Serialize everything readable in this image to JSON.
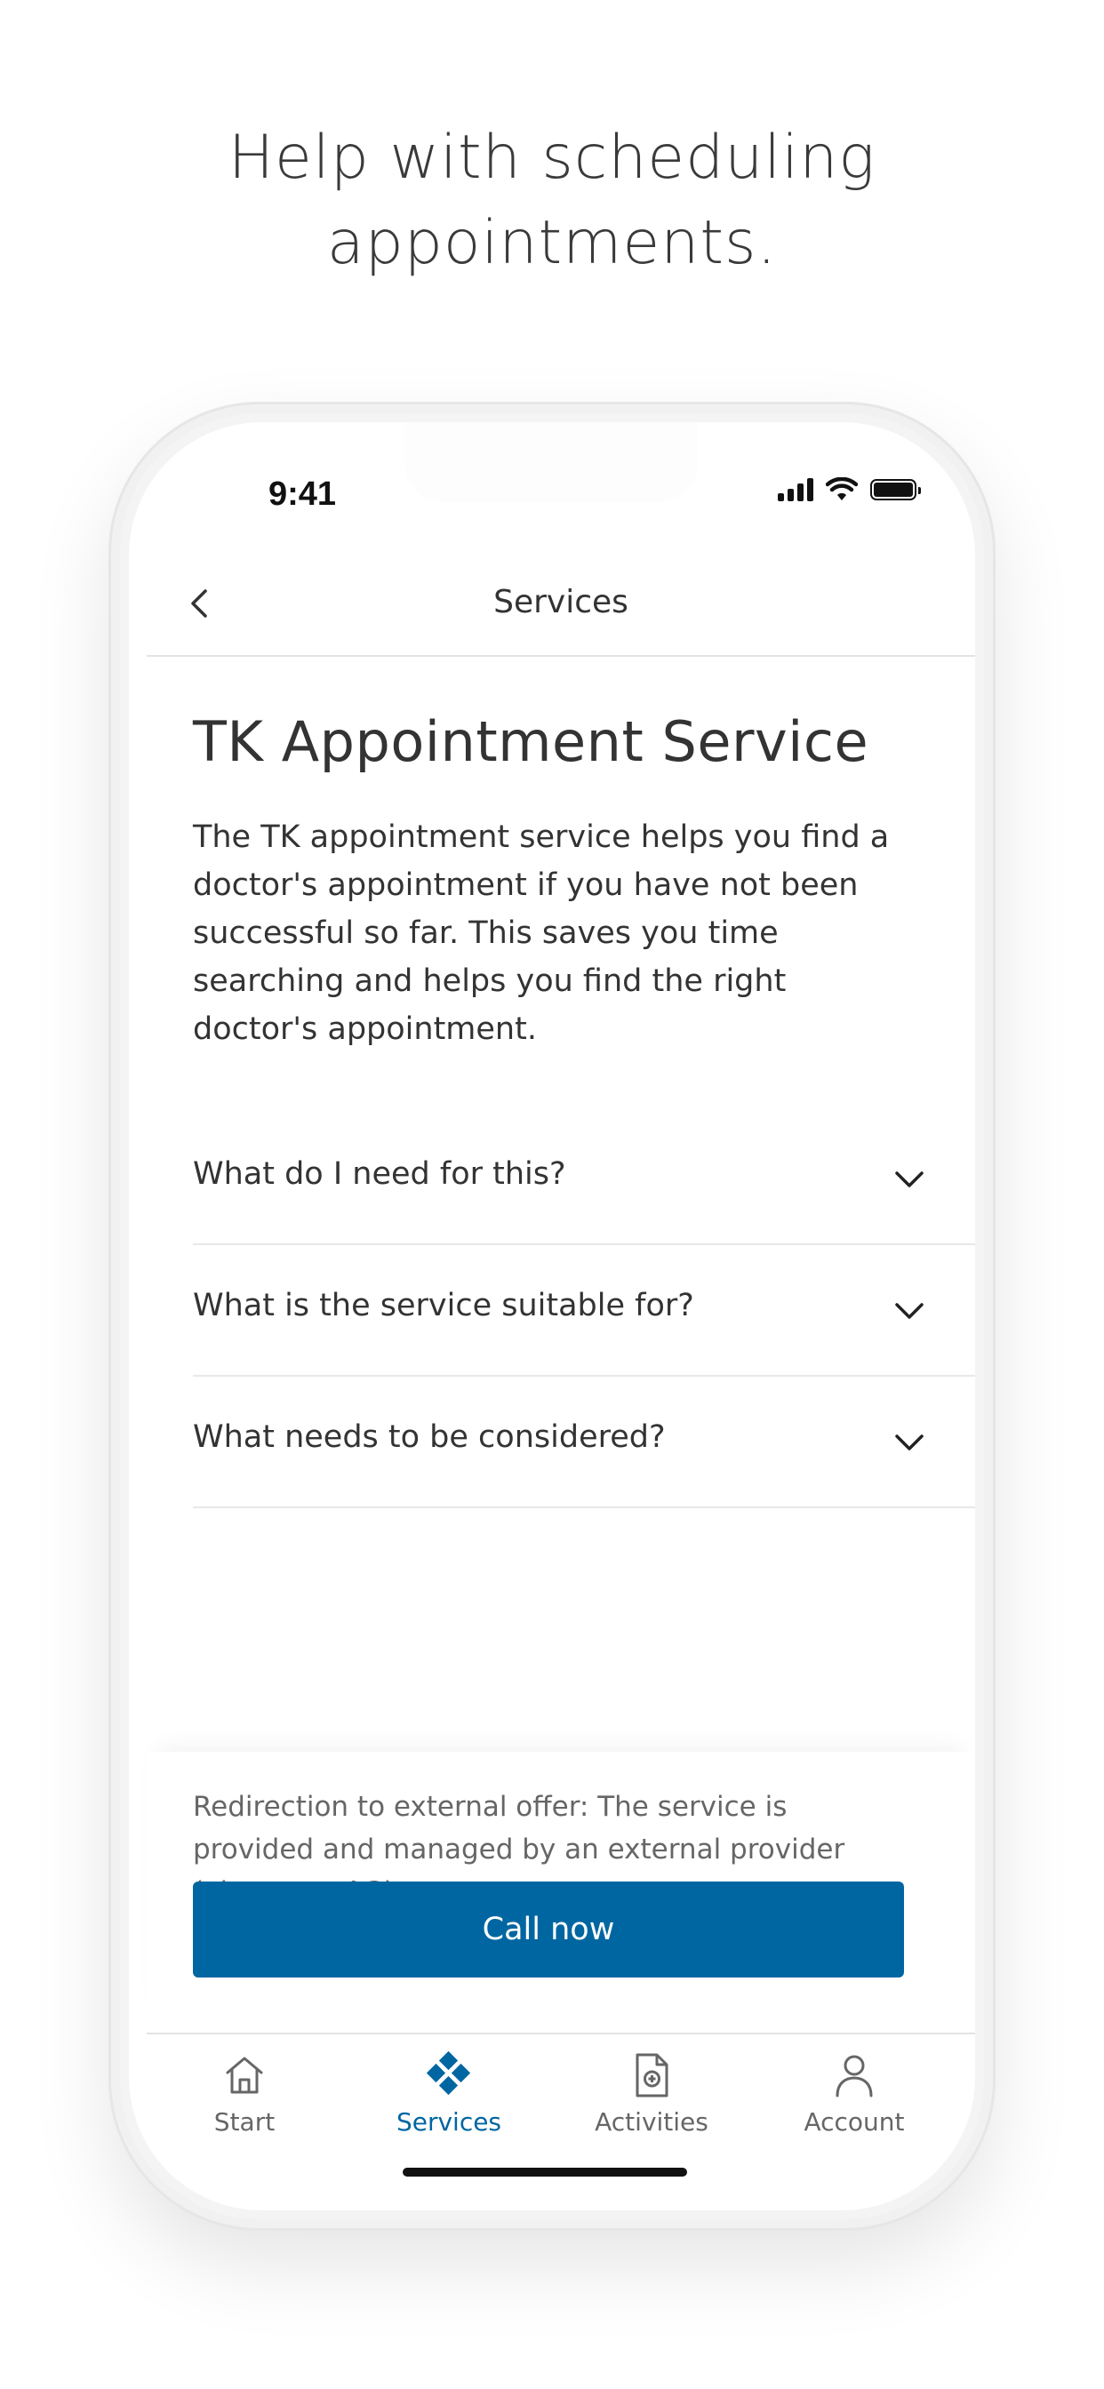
{
  "headline": {
    "line1": "Help with scheduling",
    "line2": "appointments."
  },
  "status_bar": {
    "time": "9:41"
  },
  "nav": {
    "title": "Services",
    "back_icon": "chevron-left-icon"
  },
  "main": {
    "title": "TK Appointment Service",
    "description": "The TK appointment service helps you find a doctor's appointment if you have not been successful so far. This saves you time searching and helps you find the right doctor's appointment.",
    "accordion": [
      {
        "label": "What do I need for this?"
      },
      {
        "label": "What is the service suitable for?"
      },
      {
        "label": "What needs to be considered?"
      }
    ]
  },
  "footer": {
    "note": "Redirection to external offer: The service is provided and managed by an external provider (vitagroup AG).",
    "cta_label": "Call now"
  },
  "tabbar": {
    "items": [
      {
        "label": "Start",
        "icon": "home-icon",
        "active": false
      },
      {
        "label": "Services",
        "icon": "services-diamond-icon",
        "active": true
      },
      {
        "label": "Activities",
        "icon": "document-plus-icon",
        "active": false
      },
      {
        "label": "Account",
        "icon": "person-icon",
        "active": false
      }
    ]
  },
  "colors": {
    "accent": "#0066a1",
    "text": "#333333",
    "muted": "#666666"
  }
}
